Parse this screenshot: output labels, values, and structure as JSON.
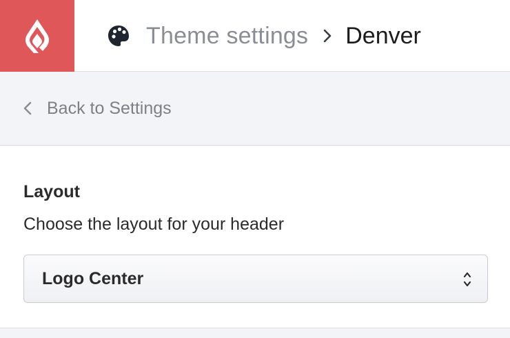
{
  "header": {
    "logo_icon": "lightspeed-flame-icon",
    "breadcrumb_icon": "palette-icon",
    "breadcrumb_parent": "Theme settings",
    "breadcrumb_separator_icon": "chevron-right-icon",
    "breadcrumb_current": "Denver"
  },
  "nav": {
    "back_icon": "chevron-left-icon",
    "back_label": "Back to Settings"
  },
  "layout_section": {
    "title": "Layout",
    "description": "Choose the layout for your header",
    "select": {
      "value": "Logo Center",
      "icon": "select-arrows-icon"
    }
  },
  "colors": {
    "brand": "#e0575a",
    "header_bg": "#ffffff",
    "page_bg": "#f2f4f8",
    "muted_text": "#8a8d93",
    "text": "#2b2b2b"
  }
}
